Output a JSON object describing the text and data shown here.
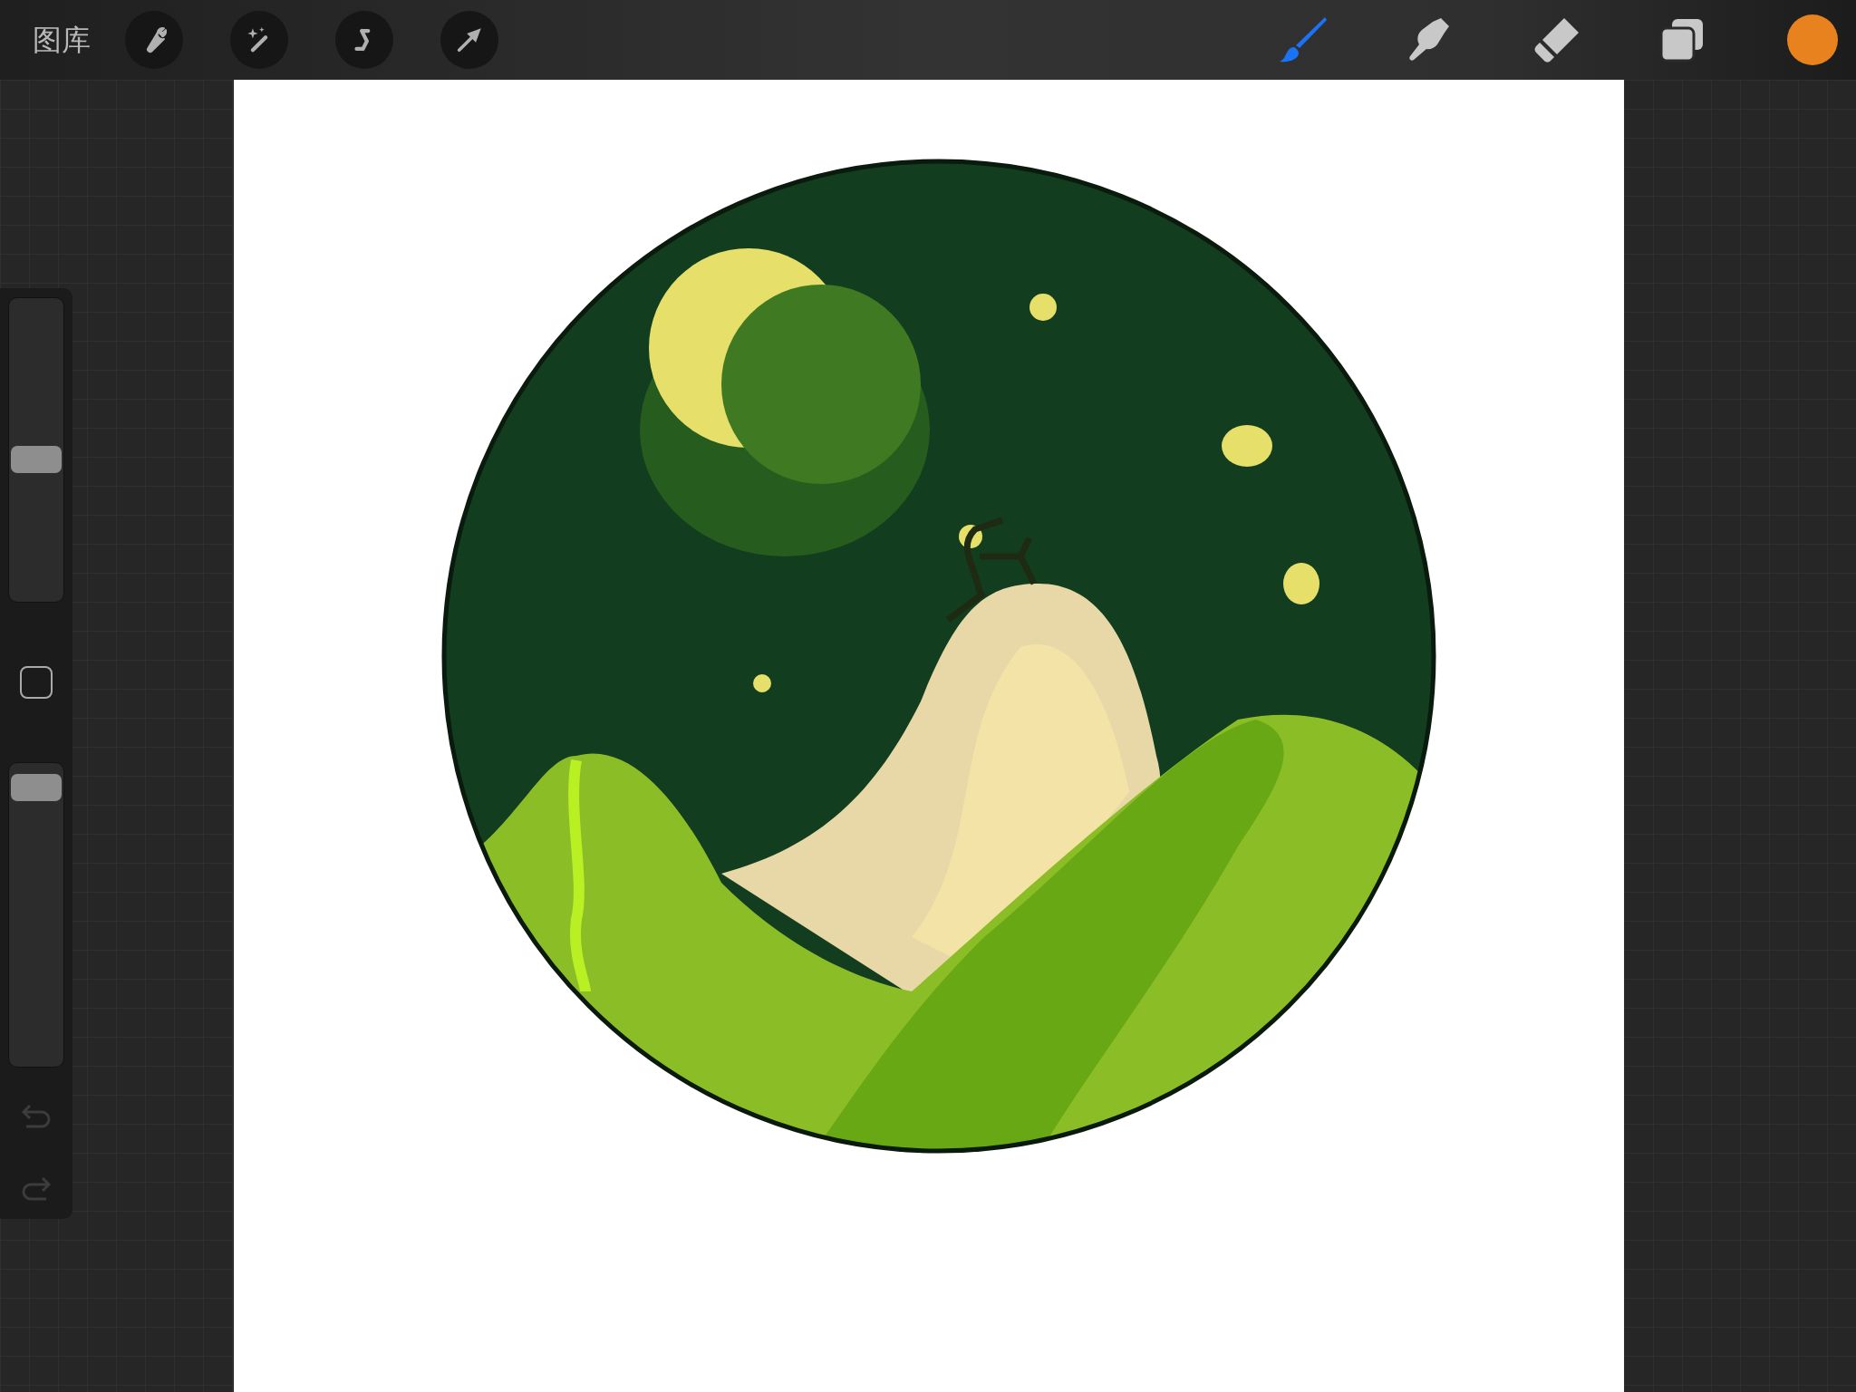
{
  "toolbar": {
    "gallery_label": "图库",
    "actions": [
      {
        "kind": "wrench"
      },
      {
        "kind": "wand"
      },
      {
        "kind": "selection"
      },
      {
        "kind": "transform"
      }
    ],
    "tools": [
      {
        "kind": "brush",
        "selected": true
      },
      {
        "kind": "smudge",
        "selected": false
      },
      {
        "kind": "eraser",
        "selected": false
      }
    ],
    "color": "#e8821e"
  },
  "sidebar": {
    "brush_size": {
      "level": 0.47
    },
    "opacity": {
      "level": 0.96
    },
    "undo": {
      "disabled": true
    },
    "redo": {
      "disabled": true
    }
  }
}
